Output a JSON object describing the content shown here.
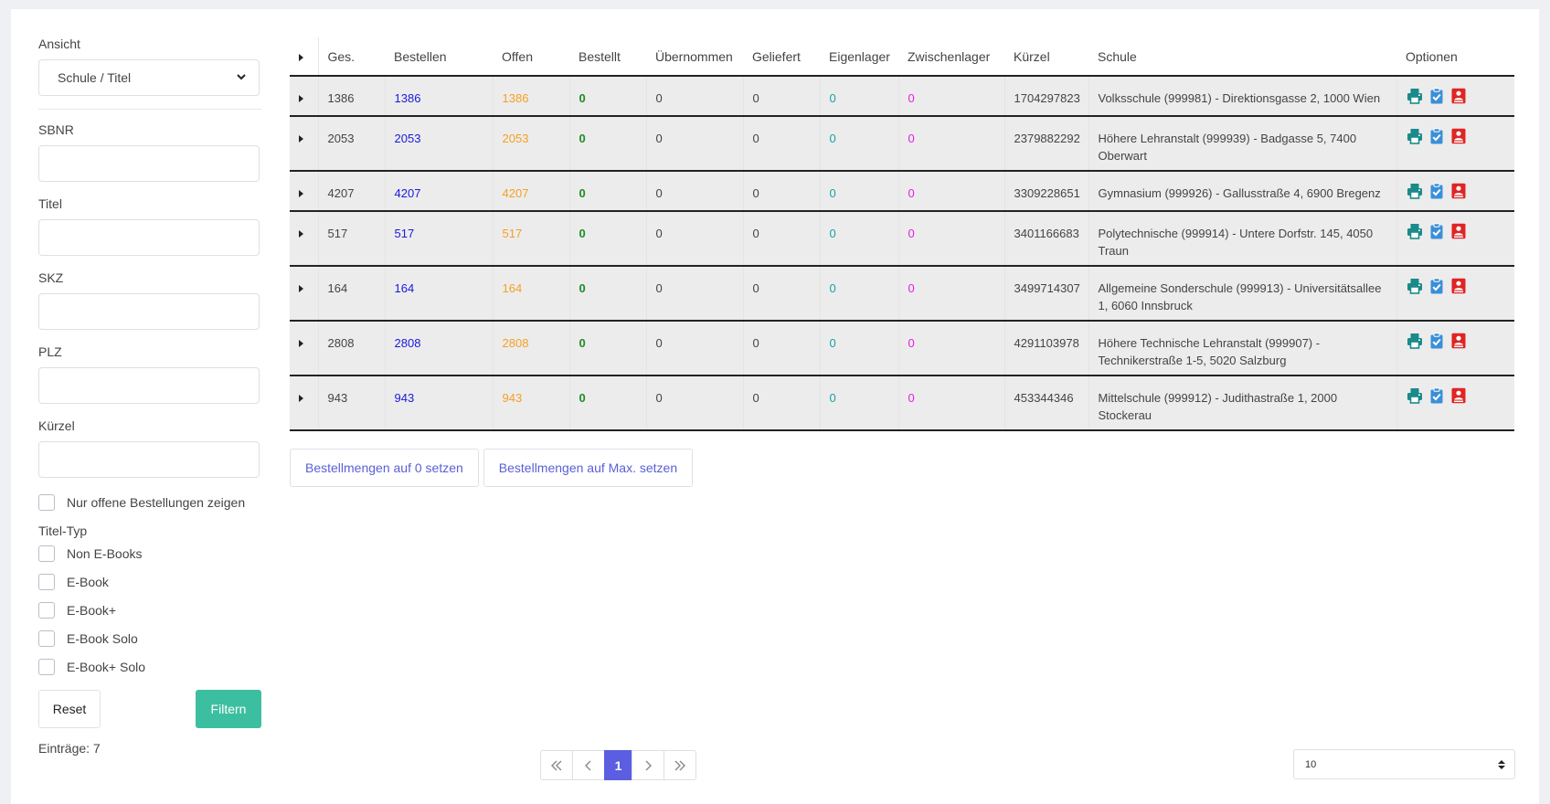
{
  "filters": {
    "view_label": "Ansicht",
    "view_value": "Schule / Titel",
    "fields": [
      {
        "label": "SBNR",
        "value": ""
      },
      {
        "label": "Titel",
        "value": ""
      },
      {
        "label": "SKZ",
        "value": ""
      },
      {
        "label": "PLZ",
        "value": ""
      },
      {
        "label": "Kürzel",
        "value": ""
      }
    ],
    "open_only_label": "Nur offene Bestellungen zeigen",
    "title_type_label": "Titel-Typ",
    "title_types": [
      "Non E-Books",
      "E-Book",
      "E-Book+",
      "E-Book Solo",
      "E-Book+ Solo"
    ],
    "reset_label": "Reset",
    "filter_label": "Filtern",
    "entries_text": "Einträge: 7"
  },
  "table": {
    "headers": [
      "Ges.",
      "Bestellen",
      "Offen",
      "Bestellt",
      "Übernommen",
      "Geliefert",
      "Eigenlager",
      "Zwischenlager",
      "Kürzel",
      "Schule",
      "Optionen"
    ],
    "rows": [
      {
        "ges": "1386",
        "bestellen": "1386",
        "offen": "1386",
        "bestellt": "0",
        "uebernommen": "0",
        "geliefert": "0",
        "eigenlager": "0",
        "zwischenlager": "0",
        "kuerzel": "1704297823",
        "schule": "Volksschule (999981) - Direktionsgasse 2, 1000 Wien"
      },
      {
        "ges": "2053",
        "bestellen": "2053",
        "offen": "2053",
        "bestellt": "0",
        "uebernommen": "0",
        "geliefert": "0",
        "eigenlager": "0",
        "zwischenlager": "0",
        "kuerzel": "2379882292",
        "schule": "Höhere Lehranstalt (999939) - Badgasse 5, 7400 Oberwart"
      },
      {
        "ges": "4207",
        "bestellen": "4207",
        "offen": "4207",
        "bestellt": "0",
        "uebernommen": "0",
        "geliefert": "0",
        "eigenlager": "0",
        "zwischenlager": "0",
        "kuerzel": "3309228651",
        "schule": "Gymnasium (999926) - Gallusstraße 4, 6900 Bregenz"
      },
      {
        "ges": "517",
        "bestellen": "517",
        "offen": "517",
        "bestellt": "0",
        "uebernommen": "0",
        "geliefert": "0",
        "eigenlager": "0",
        "zwischenlager": "0",
        "kuerzel": "3401166683",
        "schule": "Polytechnische (999914) - Untere Dorfstr. 145, 4050 Traun"
      },
      {
        "ges": "164",
        "bestellen": "164",
        "offen": "164",
        "bestellt": "0",
        "uebernommen": "0",
        "geliefert": "0",
        "eigenlager": "0",
        "zwischenlager": "0",
        "kuerzel": "3499714307",
        "schule": "Allgemeine Sonderschule (999913) - Universitätsallee 1, 6060 Innsbruck"
      },
      {
        "ges": "2808",
        "bestellen": "2808",
        "offen": "2808",
        "bestellt": "0",
        "uebernommen": "0",
        "geliefert": "0",
        "eigenlager": "0",
        "zwischenlager": "0",
        "kuerzel": "4291103978",
        "schule": "Höhere Technische Lehranstalt (999907) - Technikerstraße 1-5, 5020 Salzburg"
      },
      {
        "ges": "943",
        "bestellen": "943",
        "offen": "943",
        "bestellt": "0",
        "uebernommen": "0",
        "geliefert": "0",
        "eigenlager": "0",
        "zwischenlager": "0",
        "kuerzel": "453344346",
        "schule": "Mittelschule (999912) - Judithastraße 1, 2000 Stockerau"
      }
    ]
  },
  "actions": {
    "set_zero": "Bestellmengen auf 0 setzen",
    "set_max": "Bestellmengen auf Max. setzen"
  },
  "pagination": {
    "current_page": "1",
    "page_size": "10",
    "first_icon": "double-chevron-left-icon",
    "prev_icon": "chevron-left-icon",
    "next_icon": "chevron-right-icon",
    "last_icon": "double-chevron-right-icon"
  },
  "icons": {
    "print": "print-icon",
    "clipboard": "clipboard-check-icon",
    "delete": "delete-user-icon"
  },
  "colors": {
    "accent_green": "#3cbfa0",
    "pager_active": "#5b5ee0",
    "bestellen": "#1a1adc",
    "offen": "#f5a023",
    "bestellt": "#1f8b24",
    "eigenlager": "#1aa2a2",
    "zwischenlager": "#e51ee5",
    "print_icon": "#1a8a8a",
    "clipboard_icon": "#3a8fd8",
    "delete_icon": "#e02424"
  }
}
